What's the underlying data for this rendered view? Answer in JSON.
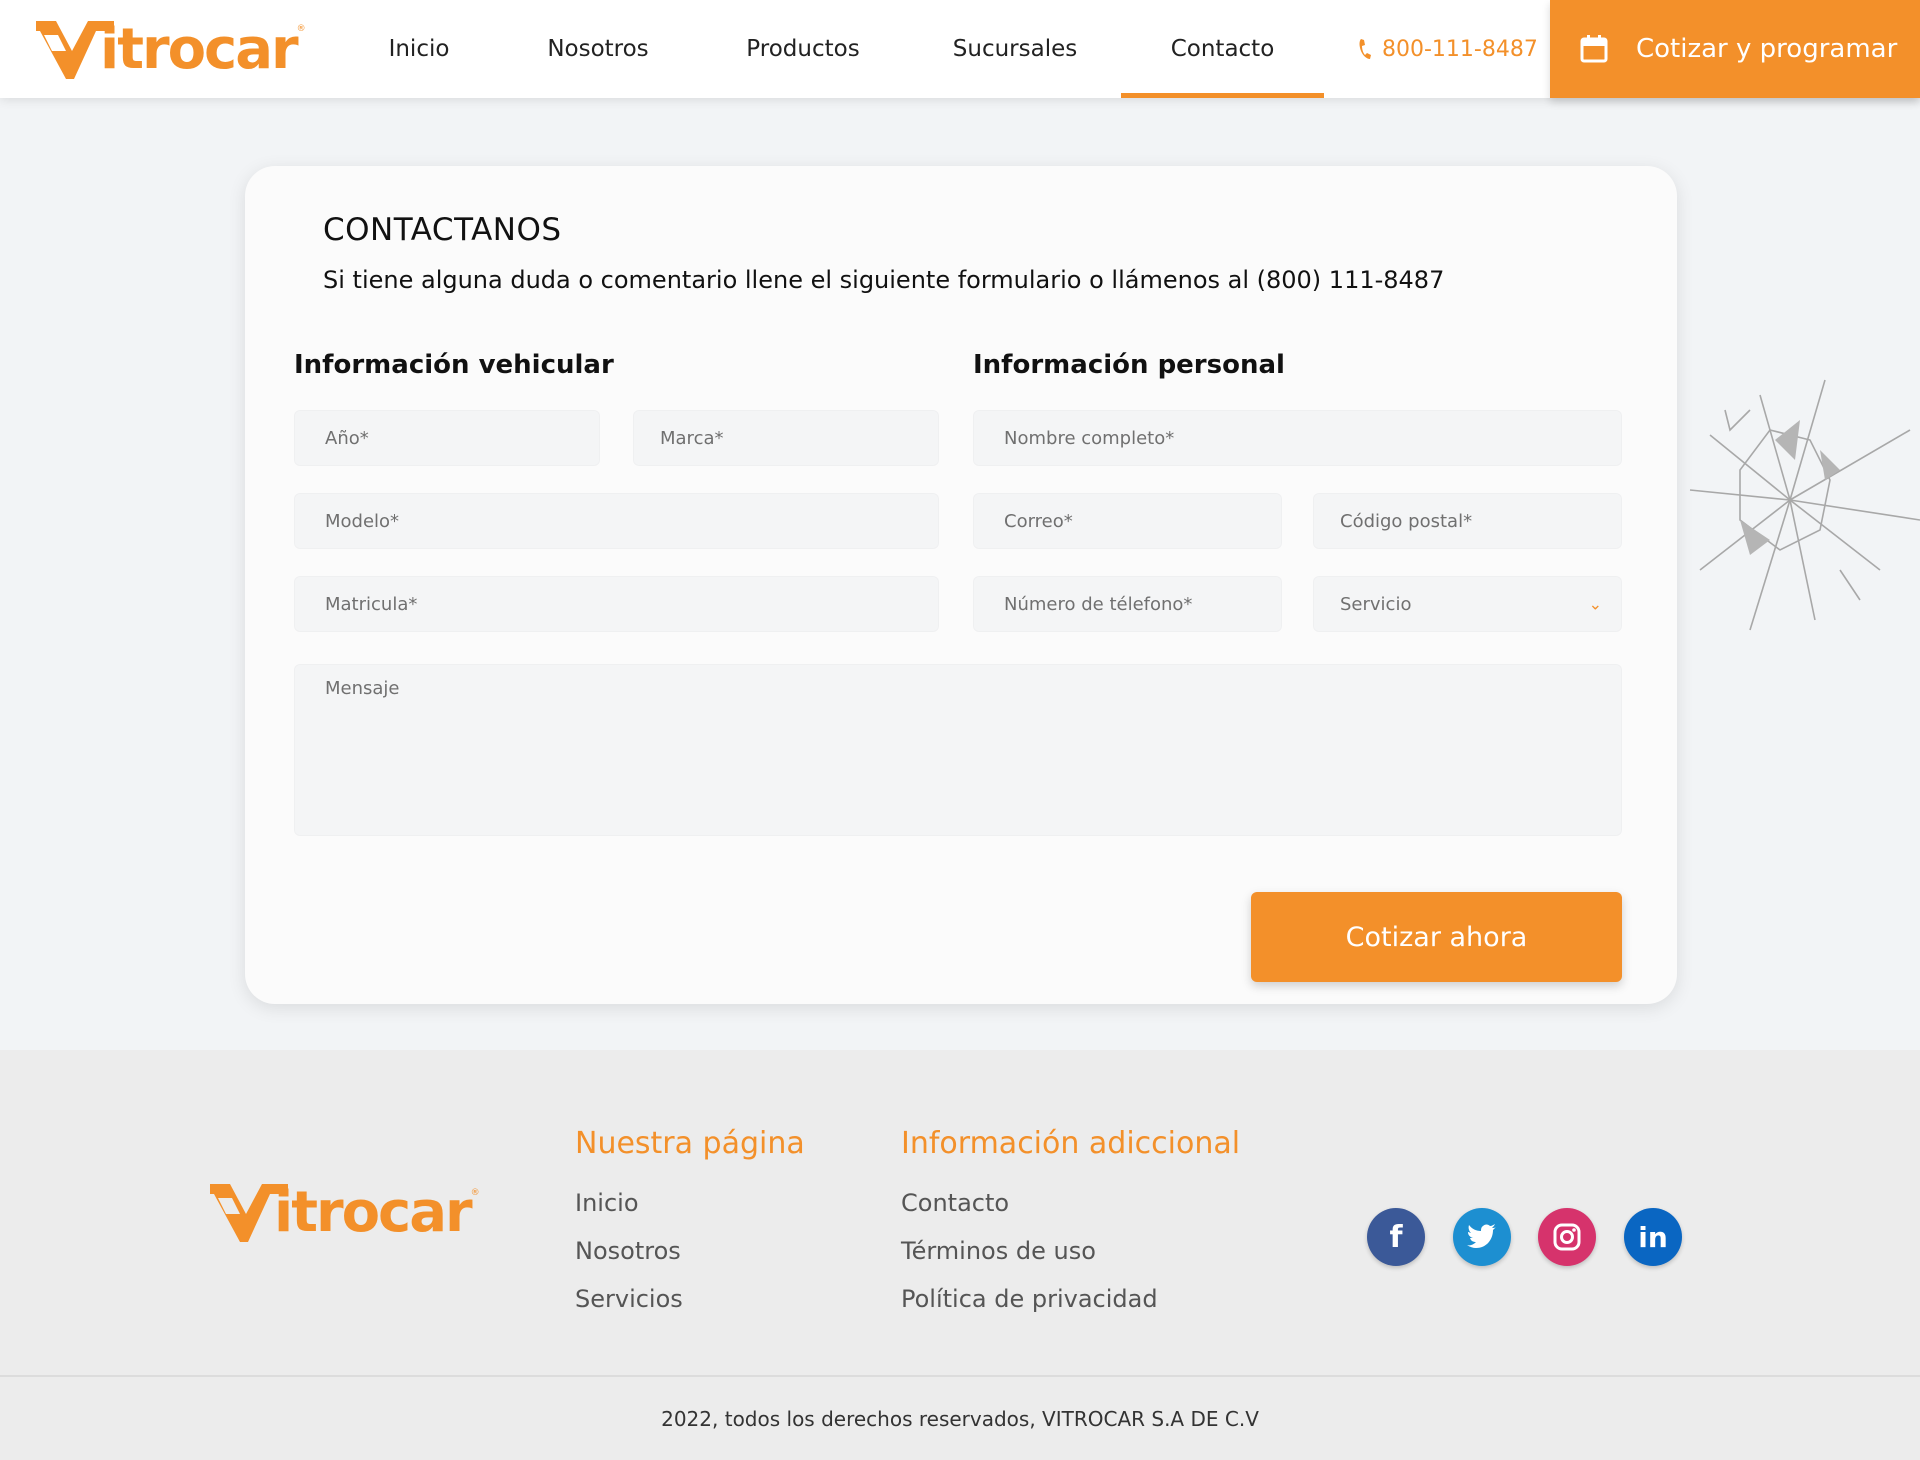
{
  "header": {
    "logo_text": "itrocar",
    "nav": [
      {
        "label": "Inicio"
      },
      {
        "label": "Nosotros"
      },
      {
        "label": "Productos"
      },
      {
        "label": "Sucursales"
      },
      {
        "label": "Contacto",
        "active": true
      }
    ],
    "phone": "800-111-8487",
    "cta_label": "Cotizar y programar"
  },
  "contact": {
    "title": "CONTACTANOS",
    "subtitle": "Si tiene alguna duda o comentario llene el siguiente formulario o llámenos al (800) 111-8487",
    "vehicle_section": "Información vehicular",
    "personal_section": "Información personal",
    "fields": {
      "year": "Año*",
      "brand": "Marca*",
      "model": "Modelo*",
      "plate": "Matricula*",
      "full_name": "Nombre completo*",
      "email": "Correo*",
      "postal_code": "Código postal*",
      "phone": "Número de télefono*",
      "service": "Servicio",
      "message": "Mensaje"
    },
    "submit_label": "Cotizar ahora"
  },
  "footer": {
    "logo_text": "itrocar",
    "our_page": {
      "title": "Nuestra página",
      "links": [
        "Inicio",
        "Nosotros",
        "Servicios"
      ]
    },
    "additional": {
      "title": "Información adiccional",
      "links": [
        "Contacto",
        "Términos de uso",
        "Política de privacidad"
      ]
    },
    "social": [
      {
        "name": "facebook-icon",
        "glyph": "f",
        "color": "#3b5998"
      },
      {
        "name": "twitter-icon",
        "glyph": "t",
        "color": "#1d8fd1"
      },
      {
        "name": "instagram-icon",
        "glyph": "◎",
        "color": "#d6336c"
      },
      {
        "name": "linkedin-icon",
        "glyph": "in",
        "color": "#0a66c2"
      }
    ],
    "copyright": "2022, todos los derechos reservados, VITROCAR S.A DE C.V"
  },
  "colors": {
    "accent": "#f3902a",
    "background": "#f2f4f6",
    "footer": "#ececec"
  }
}
